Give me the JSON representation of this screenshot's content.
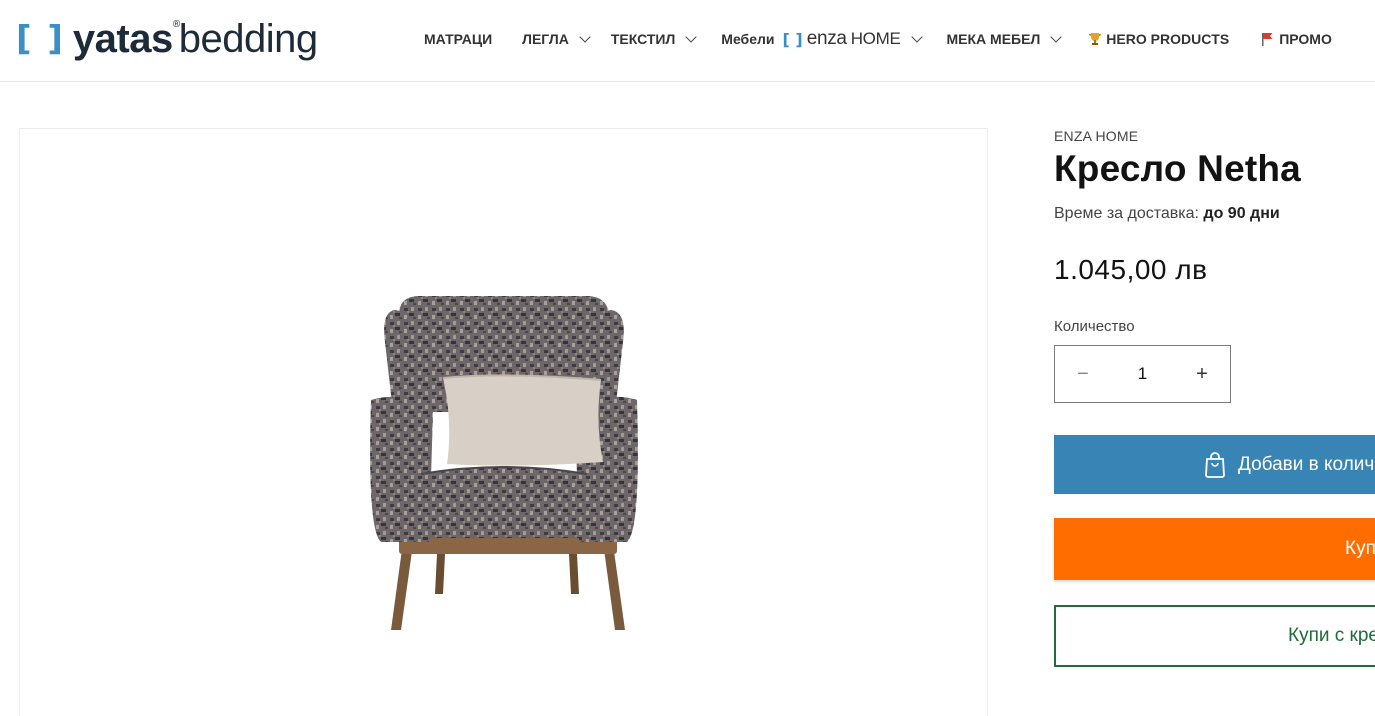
{
  "header": {
    "logo": {
      "brackets": "[ ]",
      "brand": "yatas",
      "reg": "®",
      "suffix": "bedding"
    },
    "nav": {
      "mattresses": "МАТРАЦИ",
      "beds": "ЛЕГЛА",
      "textile": "ТЕКСТИЛ",
      "furniture_prefix": "Мебели",
      "enza_brackets": "[ ]",
      "enza_word": "enza",
      "enza_home": "HOME",
      "soft_furniture": "МЕКА МЕБЕЛ",
      "hero_products": "HERO PRODUCTS",
      "promo": "ПРОМО"
    }
  },
  "product": {
    "vendor": "ENZA HOME",
    "title": "Кресло Netha",
    "delivery_label": "Време за доставка:",
    "delivery_value": "до 90 дни",
    "price": "1.045,00 лв",
    "quantity_label": "Количество",
    "quantity_value": "1",
    "minus_symbol": "−",
    "plus_symbol": "+",
    "add_to_cart_label": "Добави в количката",
    "buy_now_label": "Купи сега",
    "buy_credit_label": "Купи с кредит"
  },
  "colors": {
    "brand_blue": "#3784b5",
    "buy_orange": "#ff6c00",
    "credit_green": "#1f6b3a",
    "logo_dark": "#1d2a38"
  },
  "icons": [
    "chevron-down-icon",
    "trophy-icon",
    "flag-icon",
    "shopping-bag-icon"
  ]
}
